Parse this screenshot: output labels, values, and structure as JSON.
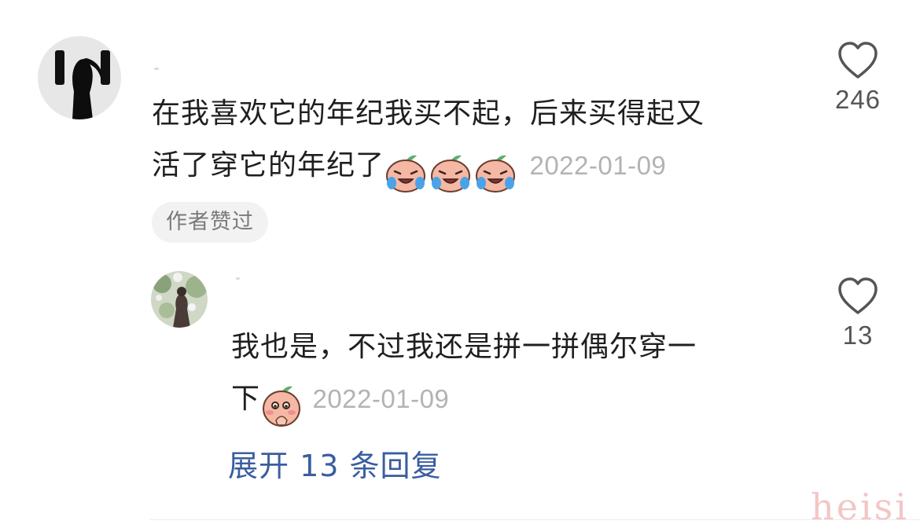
{
  "comment": {
    "text_line1": "在我喜欢它的年纪我买不起，后来买得起又",
    "text_line2": "活了穿它的年纪了",
    "date": "2022-01-09",
    "badge": "作者赞过",
    "likes": "246",
    "emoji_icon": "crying-laughing-peach-emoji"
  },
  "reply": {
    "text_line1": "我也是，不过我还是拼一拼偶尔穿一",
    "text_line2": "下",
    "date": "2022-01-09",
    "likes": "13",
    "emoji_icon": "shy-peach-emoji"
  },
  "expand_replies": "展开 13 条回复",
  "watermark": "heisi",
  "icons": {
    "like": "heart-outline-icon"
  },
  "colors": {
    "text": "#1f1f1f",
    "date": "#b3b3b3",
    "link": "#3a5da0",
    "badge_bg": "#f2f2f2"
  }
}
